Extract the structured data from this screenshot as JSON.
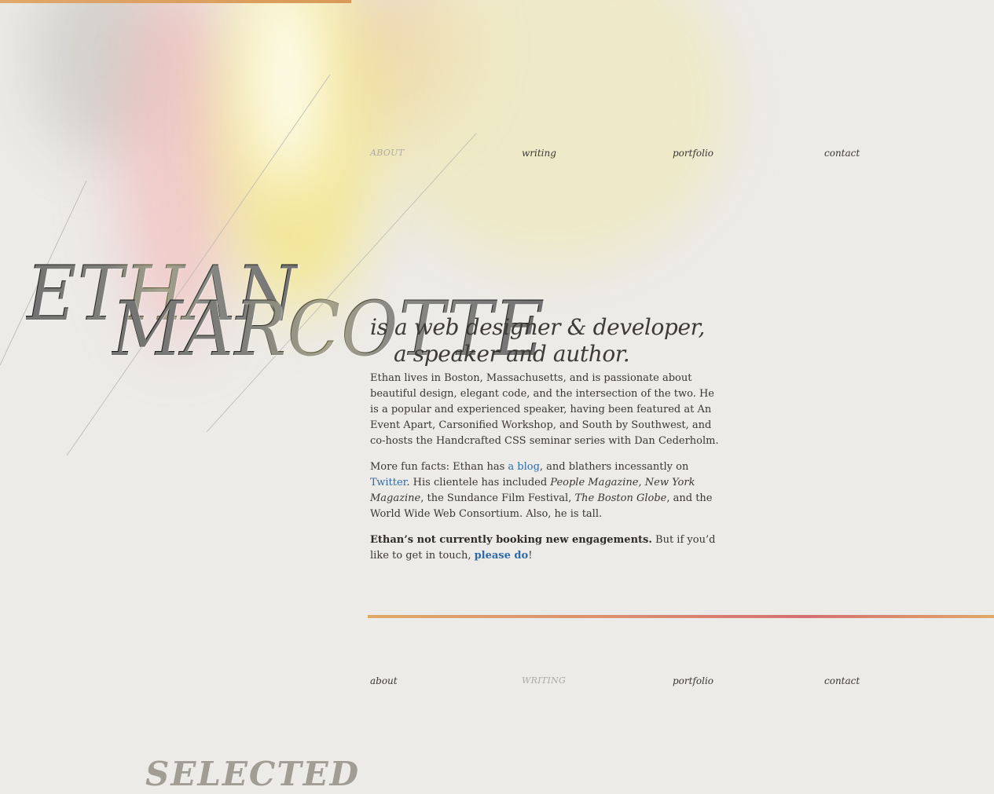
{
  "colors": {
    "background": "#ecebe8",
    "text": "#3a3633",
    "link": "#2f6aa8",
    "nav_current": "#aeaaa3",
    "rule_start": "#e0a86a",
    "rule_mid": "#d47070"
  },
  "nav_top": {
    "items": [
      {
        "label": "ABOUT",
        "current": true
      },
      {
        "label": "writing",
        "current": false
      },
      {
        "label": "portfolio",
        "current": false
      },
      {
        "label": "contact",
        "current": false
      }
    ]
  },
  "hero": {
    "first_name": "ETHAN",
    "last_name": "MARCOTTE",
    "tagline_line1": "is a web designer & developer,",
    "tagline_line2": "a speaker and author."
  },
  "bio": {
    "p1": "Ethan lives in Boston, Massachusetts, and is passionate about beautiful design, elegant code, and the intersection of the two. He is a popular and experienced speaker, having been featured at An Event Apart, Carsonified Workshop, and South by Southwest, and co-hosts the Handcrafted CSS seminar series with Dan Cederholm.",
    "p2_start": "More fun facts: Ethan has ",
    "p2_blog_link": "a blog",
    "p2_mid": ", and blathers incessantly on ",
    "p2_twitter_link": "Twitter",
    "p2_clients_intro": ". His clientele has included ",
    "p2_client1": "People Magazine",
    "p2_sep1": ", ",
    "p2_client2": "New York Magazine",
    "p2_sep2": ", the Sundance Film Festival, ",
    "p2_client3": "The Boston Globe",
    "p2_end": ", and the World Wide Web Consortium. Also, he is tall.",
    "p3_bold": "Ethan’s not currently booking new engagements.",
    "p3_mid": " But if you’d like to get in touch, ",
    "p3_link": "please do",
    "p3_end": "!"
  },
  "nav_bottom": {
    "items": [
      {
        "label": "about",
        "current": false
      },
      {
        "label": "WRITING",
        "current": true
      },
      {
        "label": "portfolio",
        "current": false
      },
      {
        "label": "contact",
        "current": false
      }
    ]
  },
  "next_section": {
    "title": "SELECTED"
  }
}
